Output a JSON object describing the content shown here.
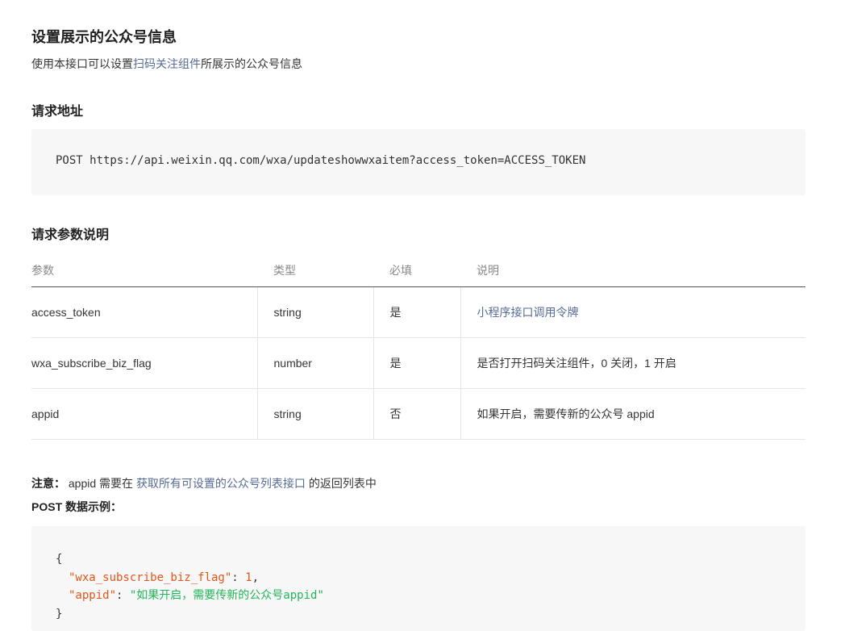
{
  "section_title": "设置展示的公众号信息",
  "intro": {
    "prefix": "使用本接口可以设置",
    "link": "扫码关注组件",
    "suffix": "所展示的公众号信息"
  },
  "request_url": {
    "heading": "请求地址",
    "url": "POST https://api.weixin.qq.com/wxa/updateshowwxaitem?access_token=ACCESS_TOKEN"
  },
  "params": {
    "heading": "请求参数说明",
    "columns": [
      "参数",
      "类型",
      "必填",
      "说明"
    ],
    "rows": [
      {
        "name": "access_token",
        "type": "string",
        "required": "是",
        "desc": "小程序接口调用令牌",
        "desc_is_link": true
      },
      {
        "name": "wxa_subscribe_biz_flag",
        "type": "number",
        "required": "是",
        "desc": "是否打开扫码关注组件，0 关闭，1 开启",
        "desc_is_link": false
      },
      {
        "name": "appid",
        "type": "string",
        "required": "否",
        "desc": "如果开启，需要传新的公众号 appid",
        "desc_is_link": false
      }
    ]
  },
  "note": {
    "label": "注意：",
    "prefix": "appid 需要在",
    "link": "获取所有可设置的公众号列表接口",
    "suffix": "的返回列表中"
  },
  "post_example": {
    "label": "POST 数据示例：",
    "open_brace": "{",
    "lines": [
      {
        "key": "\"wxa_subscribe_biz_flag\"",
        "colon": ": ",
        "value": "1",
        "value_type": "number",
        "trail": ","
      },
      {
        "key": "\"appid\"",
        "colon": ": ",
        "value": "\"如果开启，需要传新的公众号appid\"",
        "value_type": "string",
        "trail": ""
      }
    ],
    "close_brace": "}"
  }
}
